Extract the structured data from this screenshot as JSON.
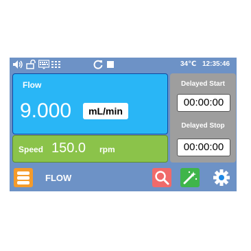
{
  "status_bar": {
    "icons": [
      "speaker-icon",
      "unlock-icon",
      "keyboard-icon",
      "lines-icon",
      "refresh-icon",
      "stop-icon"
    ],
    "temperature": "34℃",
    "time": "12:35:46"
  },
  "flow": {
    "title": "Flow",
    "value": "9.000",
    "unit": "mL/min"
  },
  "speed": {
    "label": "Speed",
    "value": "150.0",
    "unit": "rpm"
  },
  "delay": {
    "start_label": "Delayed Start",
    "start_value": "00:00:00",
    "stop_label": "Delayed Stop",
    "stop_value": "00:00:00"
  },
  "bottom_bar": {
    "mode": "FLOW",
    "buttons": [
      "menu-icon",
      "search-icon",
      "wand-icon",
      "gear-icon"
    ]
  },
  "colors": {
    "bar": "#6d92c6",
    "flow_panel": "#29b6f6",
    "speed_panel": "#8bc34a",
    "delay_panel": "#9e9e9e",
    "menu_button": "#f59b2b",
    "search_button": "#f06a6a",
    "wand_button": "#3fb54a"
  }
}
